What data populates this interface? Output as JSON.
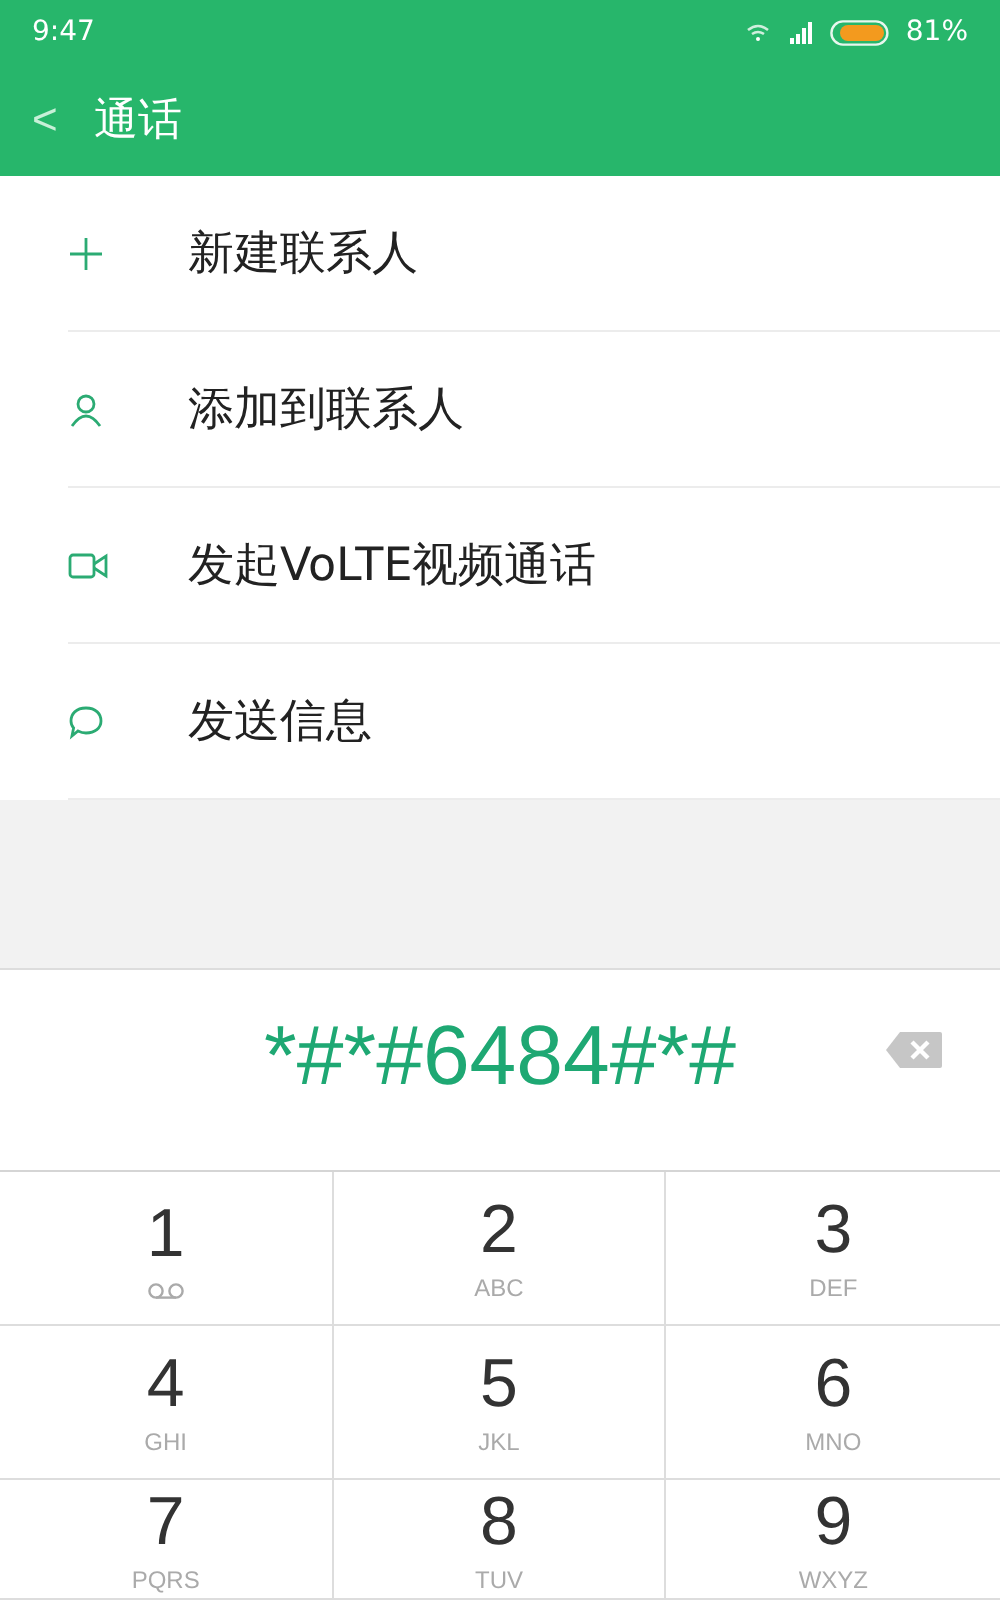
{
  "status_bar": {
    "time": "9:47",
    "battery_percent": "81%"
  },
  "header": {
    "back": "<",
    "title": "通话"
  },
  "menu": [
    {
      "kind": "add",
      "label": "新建联系人"
    },
    {
      "kind": "person",
      "label": "添加到联系人"
    },
    {
      "kind": "video",
      "label": "发起VoLTE视频通话"
    },
    {
      "kind": "message",
      "label": "发送信息"
    }
  ],
  "dialer": {
    "number": "*#*#6484#*#"
  },
  "keypad": [
    {
      "kind": "voicemail",
      "digit": "1"
    },
    {
      "kind": "letters",
      "digit": "2",
      "letters": "ABC"
    },
    {
      "kind": "letters",
      "digit": "3",
      "letters": "DEF"
    },
    {
      "kind": "letters",
      "digit": "4",
      "letters": "GHI"
    },
    {
      "kind": "letters",
      "digit": "5",
      "letters": "JKL"
    },
    {
      "kind": "letters",
      "digit": "6",
      "letters": "MNO"
    },
    {
      "kind": "letters",
      "digit": "7",
      "letters": "PQRS"
    },
    {
      "kind": "letters",
      "digit": "8",
      "letters": "TUV"
    },
    {
      "kind": "letters",
      "digit": "9",
      "letters": "WXYZ"
    }
  ]
}
